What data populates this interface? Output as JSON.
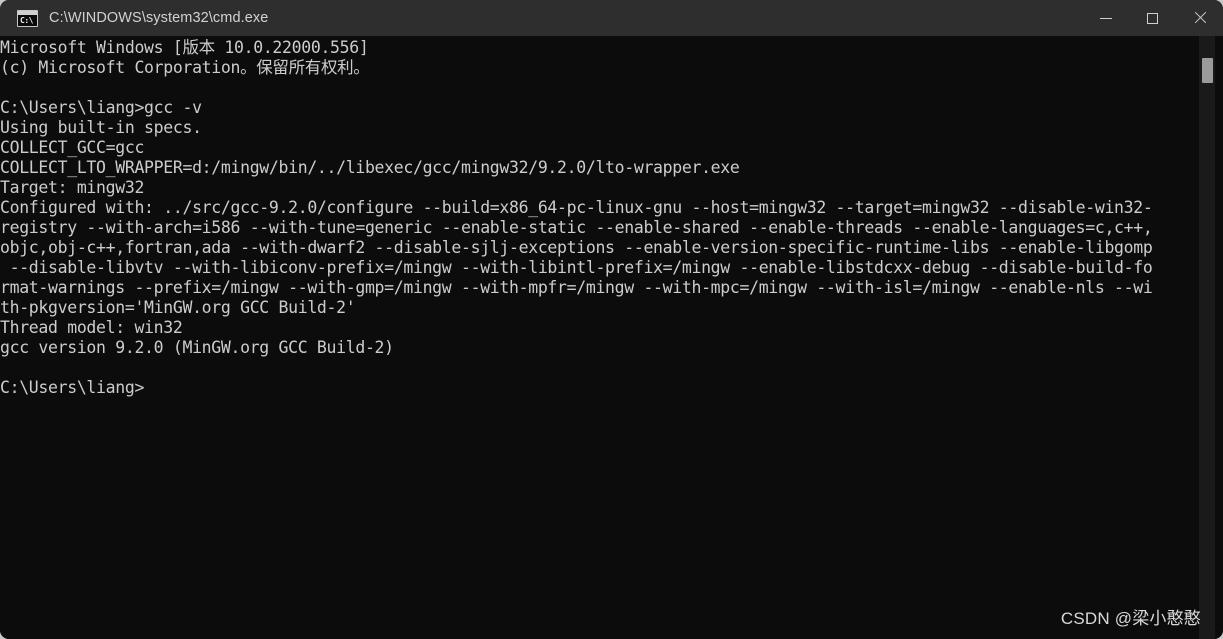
{
  "window": {
    "title": "C:\\WINDOWS\\system32\\cmd.exe",
    "icon_label": "C:\\",
    "background_color": "#0c0c0c",
    "titlebar_color": "#2e2e2e",
    "text_color": "#cccccc"
  },
  "controls": {
    "minimize_label": "—",
    "maximize_label": "□",
    "close_label": "✕"
  },
  "terminal": {
    "prompt_user_path": "C:\\Users\\liang>",
    "command": "gcc -v",
    "lines": [
      "Microsoft Windows [版本 10.0.22000.556]",
      "(c) Microsoft Corporation。保留所有权利。",
      "",
      "C:\\Users\\liang>gcc -v",
      "Using built-in specs.",
      "COLLECT_GCC=gcc",
      "COLLECT_LTO_WRAPPER=d:/mingw/bin/../libexec/gcc/mingw32/9.2.0/lto-wrapper.exe",
      "Target: mingw32",
      "Configured with: ../src/gcc-9.2.0/configure --build=x86_64-pc-linux-gnu --host=mingw32 --target=mingw32 --disable-win32-",
      "registry --with-arch=i586 --with-tune=generic --enable-static --enable-shared --enable-threads --enable-languages=c,c++,",
      "objc,obj-c++,fortran,ada --with-dwarf2 --disable-sjlj-exceptions --enable-version-specific-runtime-libs --enable-libgomp",
      " --disable-libvtv --with-libiconv-prefix=/mingw --with-libintl-prefix=/mingw --enable-libstdcxx-debug --disable-build-fo",
      "rmat-warnings --prefix=/mingw --with-gmp=/mingw --with-mpfr=/mingw --with-mpc=/mingw --with-isl=/mingw --enable-nls --wi",
      "th-pkgversion='MinGW.org GCC Build-2'",
      "Thread model: win32",
      "gcc version 9.2.0 (MinGW.org GCC Build-2)",
      "",
      "C:\\Users\\liang>"
    ],
    "gcc_version": "9.2.0",
    "gcc_target": "mingw32",
    "thread_model": "win32",
    "pkgversion": "MinGW.org GCC Build-2",
    "windows_version": "10.0.22000.556"
  },
  "watermark": {
    "text": "CSDN @梁小憨憨"
  }
}
